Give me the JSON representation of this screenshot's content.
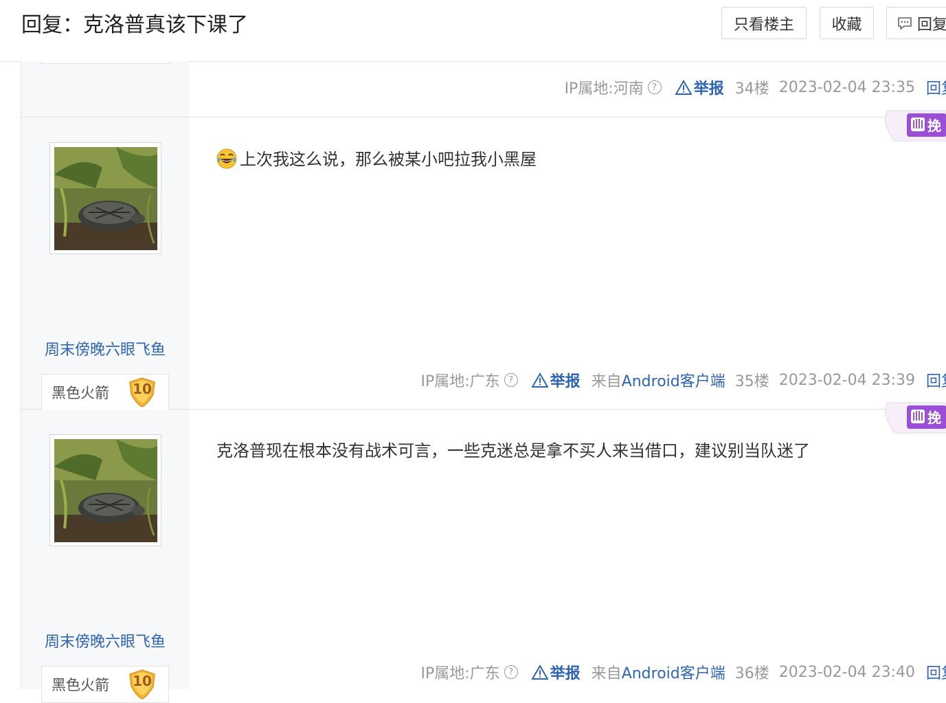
{
  "header": {
    "title": "回复：克洛普真该下课了",
    "btn_owner_only": "只看楼主",
    "btn_favorite": "收藏",
    "btn_reply": "回复"
  },
  "posts": [
    {
      "ip": "IP属地:河南",
      "qmark": "?",
      "report": "举报",
      "floor": "34楼",
      "time": "2023-02-04 23:35",
      "reply": "回复"
    },
    {
      "username": "周末傍晚六眼飞鱼",
      "badge_name": "黑色火箭",
      "badge_level": "10",
      "tag": "挽",
      "content": "上次我这么说，那么被某小吧拉我小黑屋",
      "ip": "IP属地:广东",
      "qmark": "?",
      "report": "举报",
      "from_prefix": "来自",
      "from_client": "Android客户端",
      "floor": "35楼",
      "time": "2023-02-04 23:39",
      "reply": "回复"
    },
    {
      "username": "周末傍晚六眼飞鱼",
      "badge_name": "黑色火箭",
      "badge_level": "10",
      "tag": "挽",
      "content": "克洛普现在根本没有战术可言，一些克迷总是拿不买人来当借口，建议别当队迷了",
      "ip": "IP属地:广东",
      "qmark": "?",
      "report": "举报",
      "from_prefix": "来自",
      "from_client": "Android客户端",
      "floor": "36楼",
      "time": "2023-02-04 23:40",
      "reply": "回复"
    }
  ],
  "colors": {
    "link": "#2d64b3",
    "meta": "#999999",
    "tag_purple": "#9b4fd6",
    "badge_gold": "#f2b531"
  }
}
